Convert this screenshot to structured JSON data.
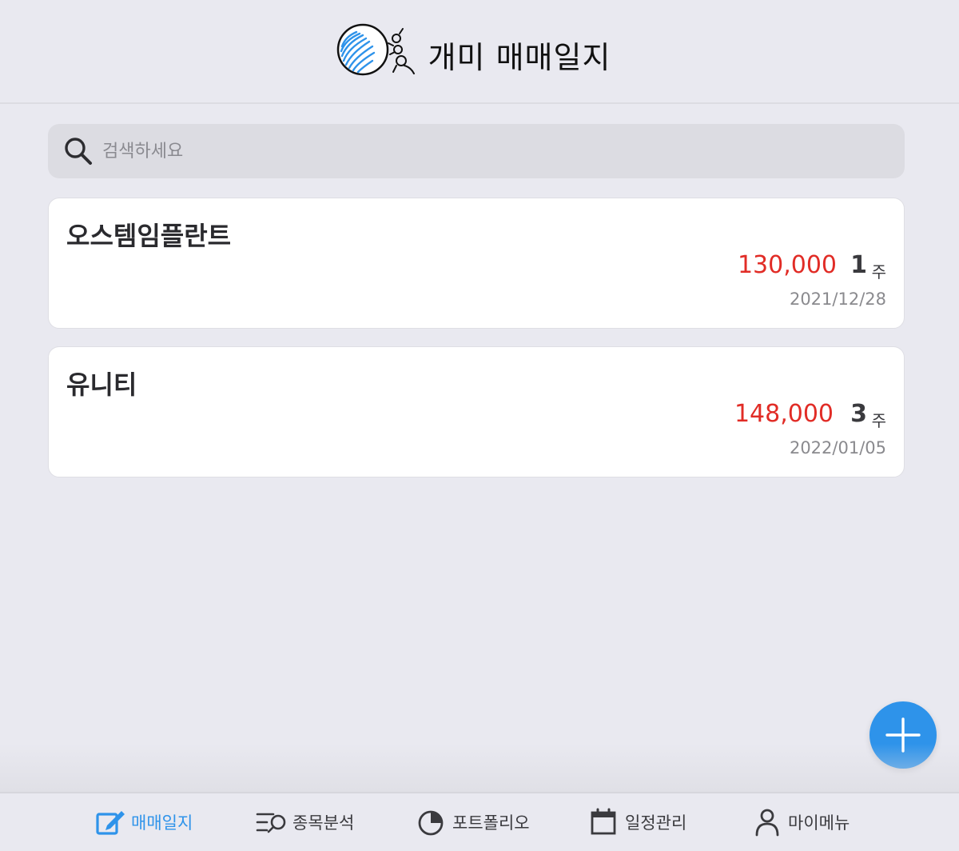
{
  "header": {
    "title": "개미 매매일지",
    "logo": "ant-pushing-ball-logo"
  },
  "search": {
    "placeholder": "검색하세요",
    "icon": "search-icon"
  },
  "trades": [
    {
      "name": "오스템임플란트",
      "price": "130,000",
      "quantity": "1",
      "unit": "주",
      "date": "2021/12/28"
    },
    {
      "name": "유니티",
      "price": "148,000",
      "quantity": "3",
      "unit": "주",
      "date": "2022/01/05"
    }
  ],
  "fab": {
    "icon": "plus-icon"
  },
  "tabs": [
    {
      "label": "매매일지",
      "icon": "edit-icon",
      "active": true
    },
    {
      "label": "종목분석",
      "icon": "list-search-icon",
      "active": false
    },
    {
      "label": "포트폴리오",
      "icon": "pie-chart-icon",
      "active": false
    },
    {
      "label": "일정관리",
      "icon": "calendar-icon",
      "active": false
    },
    {
      "label": "마이메뉴",
      "icon": "person-icon",
      "active": false
    }
  ],
  "colors": {
    "accent": "#2e93ea",
    "price": "#e12c26",
    "background": "#e9e9f0"
  }
}
